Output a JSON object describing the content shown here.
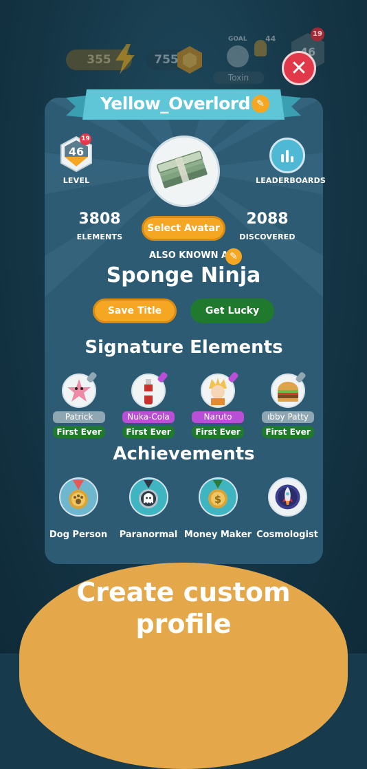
{
  "hud": {
    "coins": "355",
    "gems": "755",
    "goal_label": "GOAL",
    "goal_count": "44",
    "goal_name": "Toxin",
    "level": "46",
    "level_badge": "19"
  },
  "profile": {
    "username": "Yellow_Overlord",
    "level_value": "46",
    "level_badge": "19",
    "level_label": "LEVEL",
    "leaderboards_label": "LEADERBOARDS",
    "elements_count": "3808",
    "elements_label": "ELEMENTS",
    "discovered_count": "2088",
    "discovered_label": "DISCOVERED",
    "select_avatar_label": "Select Avatar",
    "aka_label": "ALSO KNOWN AS",
    "title": "Sponge Ninja",
    "save_title_label": "Save Title",
    "get_lucky_label": "Get Lucky"
  },
  "signature": {
    "heading": "Signature Elements",
    "items": [
      {
        "name": "Patrick",
        "badge": "First Ever",
        "tag_color": "#8fa6b3"
      },
      {
        "name": "Nuka-Cola",
        "badge": "First Ever",
        "tag_color": "#b84fd6"
      },
      {
        "name": "Naruto",
        "badge": "First Ever",
        "tag_color": "#b84fd6"
      },
      {
        "name": "ıbby Patty",
        "badge": "First Ever",
        "tag_color": "#8fa6b3"
      }
    ]
  },
  "achievements": {
    "heading": "Achievements",
    "items": [
      {
        "name": "Dog Person",
        "icon": "paw-medal-icon",
        "color": "#6fb7cf"
      },
      {
        "name": "Paranormal",
        "icon": "ghost-medal-icon",
        "color": "#3fb5c2"
      },
      {
        "name": "Money Maker",
        "icon": "dollar-medal-icon",
        "color": "#3fb5c2"
      },
      {
        "name": "Cosmologist",
        "icon": "rocket-medal-icon",
        "color": "#eef2f5"
      }
    ]
  },
  "promo": {
    "line1": "Create custom",
    "line2": "profile"
  },
  "colors": {
    "card": "#2e5b74",
    "accent_orange": "#f5a623",
    "green": "#1f7a2e",
    "close_red": "#e2394a",
    "ribbon": "#5ec6d6"
  }
}
